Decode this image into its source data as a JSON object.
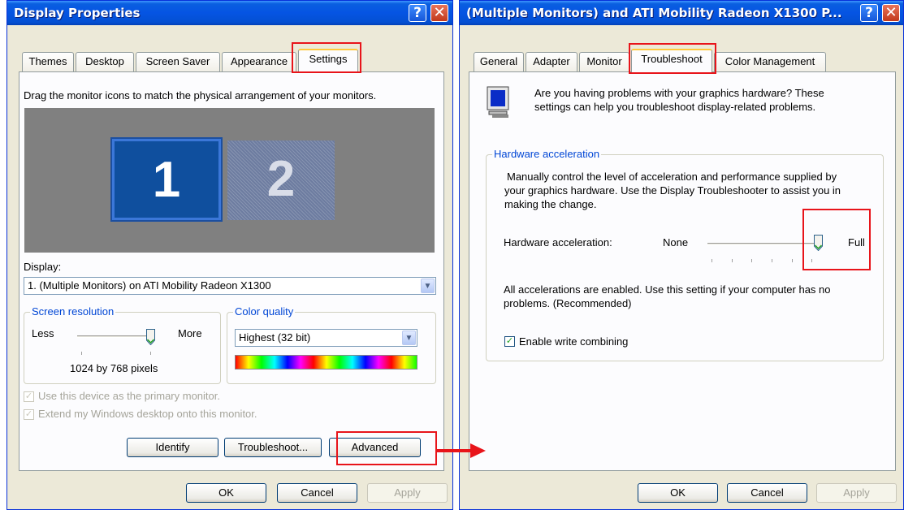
{
  "left_window": {
    "title": "Display Properties",
    "tabs": [
      "Themes",
      "Desktop",
      "Screen Saver",
      "Appearance",
      "Settings"
    ],
    "active_tab": "Settings",
    "instruction": "Drag the monitor icons to match the physical arrangement of your monitors.",
    "monitor_labels": [
      "1",
      "2"
    ],
    "display_label": "Display:",
    "display_value": "1. (Multiple Monitors) on ATI Mobility Radeon X1300",
    "resolution": {
      "label": "Screen resolution",
      "less": "Less",
      "more": "More",
      "value_text": "1024 by 768 pixels",
      "slider_position": 0.92
    },
    "color": {
      "label": "Color quality",
      "value": "Highest (32 bit)"
    },
    "checkbox_primary": "Use this device as the primary monitor.",
    "checkbox_extend": "Extend my Windows desktop onto this monitor.",
    "buttons": {
      "identify": "Identify",
      "troubleshoot": "Troubleshoot...",
      "advanced": "Advanced"
    },
    "footer": {
      "ok": "OK",
      "cancel": "Cancel",
      "apply": "Apply"
    }
  },
  "right_window": {
    "title": "(Multiple Monitors) and ATI Mobility Radeon X1300 P...",
    "tabs": [
      "General",
      "Adapter",
      "Monitor",
      "Troubleshoot",
      "Color Management"
    ],
    "active_tab": "Troubleshoot",
    "intro": [
      "Are you having problems with your graphics hardware? These",
      "settings can help you troubleshoot display-related problems."
    ],
    "hw_group_label": "Hardware acceleration",
    "hw_description": [
      "Manually control the level of acceleration and performance supplied by",
      "your graphics hardware. Use the Display Troubleshooter to assist you in",
      "making the change."
    ],
    "hw_label": "Hardware acceleration:",
    "none": "None",
    "full": "Full",
    "accel_level": 1.0,
    "status": [
      "All accelerations are enabled. Use this setting if your computer has no",
      "problems. (Recommended)"
    ],
    "write_combining": "Enable write combining",
    "footer": {
      "ok": "OK",
      "cancel": "Cancel",
      "apply": "Apply"
    }
  },
  "colors": {
    "annotation_red": "#e8141a",
    "title_blue": "#0554e3",
    "group_label_blue": "#0046d5",
    "monitor_blue": "#0f4f9e"
  },
  "icons": [
    "help-icon",
    "close-icon",
    "chevron-down-icon",
    "monitor-icon",
    "slider-thumb-icon",
    "red-arrow"
  ]
}
